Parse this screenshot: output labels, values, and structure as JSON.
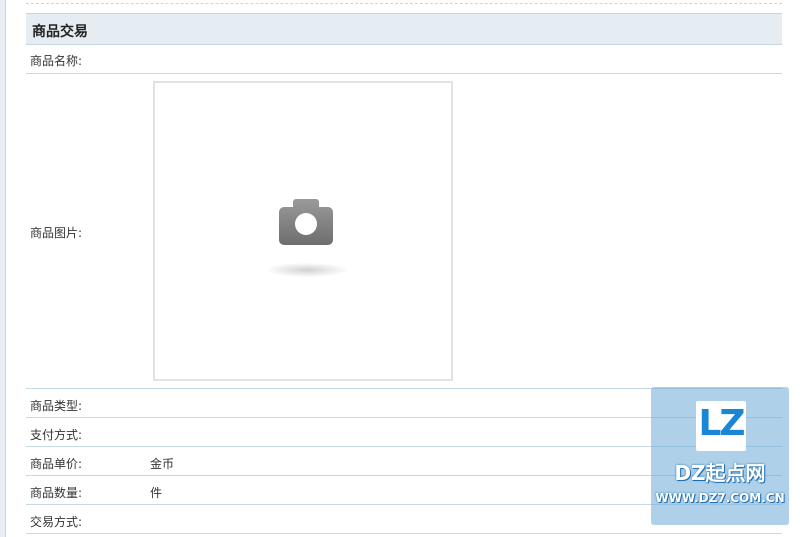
{
  "header": {
    "title": "商品交易"
  },
  "fields": [
    {
      "label": "商品名称:",
      "value": ""
    },
    {
      "label": "商品图片:",
      "value": ""
    },
    {
      "label": "商品类型:",
      "value": ""
    },
    {
      "label": "支付方式:",
      "value": ""
    },
    {
      "label": "商品单价:",
      "value": "金币"
    },
    {
      "label": "商品数量:",
      "value": "件"
    },
    {
      "label": "交易方式:",
      "value": ""
    }
  ],
  "image_placeholder": {
    "icon": "camera-icon"
  },
  "watermark": {
    "logo": "LZ",
    "name": "DZ起点网",
    "url": "WWW.DZ7.COM.CN"
  }
}
